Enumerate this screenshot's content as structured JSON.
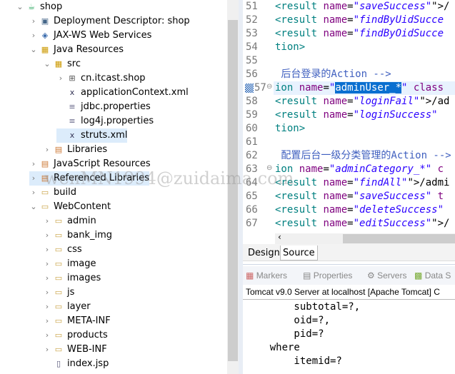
{
  "tree": [
    {
      "label": "shop",
      "level": 0,
      "chev": "v",
      "icon": "project-icon"
    },
    {
      "label": "Deployment Descriptor: shop",
      "level": 1,
      "chev": ">",
      "icon": "deployment-descriptor-icon"
    },
    {
      "label": "JAX-WS Web Services",
      "level": 1,
      "chev": ">",
      "icon": "web-services-icon"
    },
    {
      "label": "Java Resources",
      "level": 1,
      "chev": "v",
      "icon": "java-resources-icon"
    },
    {
      "label": "src",
      "level": 2,
      "chev": "v",
      "icon": "source-folder-icon"
    },
    {
      "label": "cn.itcast.shop",
      "level": 3,
      "chev": ">",
      "icon": "package-icon"
    },
    {
      "label": "applicationContext.xml",
      "level": 3,
      "chev": "",
      "icon": "xml-file-icon"
    },
    {
      "label": "jdbc.properties",
      "level": 3,
      "chev": "",
      "icon": "properties-file-icon"
    },
    {
      "label": "log4j.properties",
      "level": 3,
      "chev": "",
      "icon": "properties-file-icon"
    },
    {
      "label": "struts.xml",
      "level": 3,
      "chev": "",
      "icon": "xml-file-icon",
      "selected": true
    },
    {
      "label": "Libraries",
      "level": 2,
      "chev": ">",
      "icon": "library-icon"
    },
    {
      "label": "JavaScript Resources",
      "level": 1,
      "chev": ">",
      "icon": "library-icon"
    },
    {
      "label": "Referenced Libraries",
      "level": 1,
      "chev": ">",
      "icon": "library-icon",
      "hover": true
    },
    {
      "label": "build",
      "level": 1,
      "chev": ">",
      "icon": "folder-icon"
    },
    {
      "label": "WebContent",
      "level": 1,
      "chev": "v",
      "icon": "folder-icon"
    },
    {
      "label": "admin",
      "level": 2,
      "chev": ">",
      "icon": "folder-icon"
    },
    {
      "label": "bank_img",
      "level": 2,
      "chev": ">",
      "icon": "folder-icon"
    },
    {
      "label": "css",
      "level": 2,
      "chev": ">",
      "icon": "folder-icon"
    },
    {
      "label": "image",
      "level": 2,
      "chev": ">",
      "icon": "folder-icon"
    },
    {
      "label": "images",
      "level": 2,
      "chev": ">",
      "icon": "folder-icon"
    },
    {
      "label": "js",
      "level": 2,
      "chev": ">",
      "icon": "folder-icon"
    },
    {
      "label": "layer",
      "level": 2,
      "chev": ">",
      "icon": "folder-icon"
    },
    {
      "label": "META-INF",
      "level": 2,
      "chev": ">",
      "icon": "folder-icon"
    },
    {
      "label": "products",
      "level": 2,
      "chev": ">",
      "icon": "folder-icon"
    },
    {
      "label": "WEB-INF",
      "level": 2,
      "chev": ">",
      "icon": "folder-icon"
    },
    {
      "label": "index.jsp",
      "level": 2,
      "chev": "",
      "icon": "jsp-file-icon"
    }
  ],
  "editor": {
    "lines": [
      {
        "n": "51",
        "parts": [
          [
            "tag",
            "<result "
          ],
          [
            "attr",
            "name"
          ],
          [
            "",
            "="
          ],
          [
            "str",
            "\"saveSuccess\""
          ],
          [
            "",
            "\">/"
          ]
        ]
      },
      {
        "n": "52",
        "parts": [
          [
            "tag",
            "<result "
          ],
          [
            "attr",
            "name"
          ],
          [
            "",
            "="
          ],
          [
            "str",
            "\"findByUidSucce"
          ]
        ]
      },
      {
        "n": "53",
        "parts": [
          [
            "tag",
            "<result "
          ],
          [
            "attr",
            "name"
          ],
          [
            "",
            "="
          ],
          [
            "str",
            "\"findByOidSucce"
          ]
        ]
      },
      {
        "n": "54",
        "parts": [
          [
            "tag",
            "tion>"
          ]
        ]
      },
      {
        "n": "55",
        "parts": []
      },
      {
        "n": "56",
        "parts": [
          [
            "cmt",
            " 后台登录的Action -->"
          ]
        ]
      },
      {
        "n": "57",
        "hl": true,
        "parts": [
          [
            "tag",
            "ion "
          ],
          [
            "attr",
            "name"
          ],
          [
            "",
            "="
          ],
          [
            "str",
            "\""
          ],
          [
            "selt",
            "adminUser_*"
          ],
          [
            "str",
            "\""
          ],
          [
            "attr",
            " class"
          ]
        ]
      },
      {
        "n": "58",
        "parts": [
          [
            "tag",
            "<result "
          ],
          [
            "attr",
            "name"
          ],
          [
            "",
            "="
          ],
          [
            "str",
            "\"loginFail\""
          ],
          [
            "",
            "\">/ad"
          ]
        ]
      },
      {
        "n": "59",
        "parts": [
          [
            "tag",
            "<result "
          ],
          [
            "attr",
            "name"
          ],
          [
            "",
            "="
          ],
          [
            "str",
            "\"loginSuccess\""
          ]
        ]
      },
      {
        "n": "60",
        "parts": [
          [
            "tag",
            "tion>"
          ]
        ]
      },
      {
        "n": "61",
        "parts": []
      },
      {
        "n": "62",
        "parts": [
          [
            "cmt",
            " 配置后台一级分类管理的Action -->"
          ]
        ]
      },
      {
        "n": "63",
        "parts": [
          [
            "tag",
            "ion "
          ],
          [
            "attr",
            "name"
          ],
          [
            "",
            "="
          ],
          [
            "str",
            "\"adminCategory_*\""
          ],
          [
            "attr",
            " c"
          ]
        ]
      },
      {
        "n": "64",
        "parts": [
          [
            "tag",
            "<result "
          ],
          [
            "attr",
            "name"
          ],
          [
            "",
            "="
          ],
          [
            "str",
            "\"findAll\""
          ],
          [
            "",
            "\">/admi"
          ]
        ]
      },
      {
        "n": "65",
        "parts": [
          [
            "tag",
            "<result "
          ],
          [
            "attr",
            "name"
          ],
          [
            "",
            "="
          ],
          [
            "str",
            "\"saveSuccess\""
          ],
          [
            "attr",
            " t"
          ]
        ]
      },
      {
        "n": "66",
        "parts": [
          [
            "tag",
            "<result "
          ],
          [
            "attr",
            "name"
          ],
          [
            "",
            "="
          ],
          [
            "str",
            "\"deleteSuccess\""
          ]
        ]
      },
      {
        "n": "67",
        "parts": [
          [
            "tag",
            "<result "
          ],
          [
            "attr",
            "name"
          ],
          [
            "",
            "="
          ],
          [
            "str",
            "\"editSuccess\""
          ],
          [
            "",
            "\">/"
          ]
        ]
      }
    ],
    "tabs": [
      "Design",
      "Source"
    ],
    "active_tab": "Source"
  },
  "bottom": {
    "tabs": [
      "Markers",
      "Properties",
      "Servers",
      "Data S"
    ],
    "console_title": "Tomcat v9.0 Server at localhost [Apache Tomcat] C",
    "console_lines": [
      "        subtotal=?,",
      "        oid=?,",
      "        pid=?",
      "    where",
      "        itemid=?"
    ]
  },
  "watermark": "wenMN1994@zuidaima.com"
}
